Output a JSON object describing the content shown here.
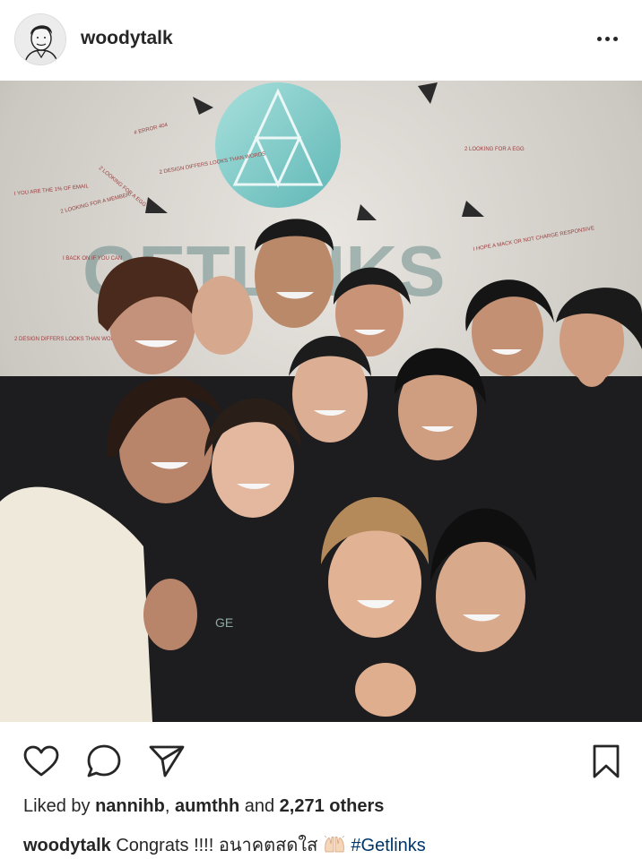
{
  "post": {
    "username": "woodytalk",
    "more_icon": "more-horizontal-icon"
  },
  "photo": {
    "wall_sign": "GETLINKS",
    "shirt_print": "GE",
    "wall_stickers": [
      "# ERROR 404",
      "2 LOOKING FOR A EGG",
      "2 DESIGN DIFFERS LOOKS THAN WORDS",
      "2 LOOKING FOR A MEMBER",
      "I BACK ON IF YOU CAN",
      "I HOPE A MACK OR NOT CHARGE RESPONSIVE",
      "2 DESIGN DIFFERS LOOKS THAN WORDS",
      "I YOU ARE THE 1% OF EMAIL",
      "2 LOOKING FOR A EGG"
    ]
  },
  "actions": {
    "like_icon": "heart-icon",
    "comment_icon": "comment-icon",
    "share_icon": "paper-plane-icon",
    "save_icon": "bookmark-icon"
  },
  "likes": {
    "prefix": "Liked by ",
    "user1": "nannihb",
    "sep": ", ",
    "user2": "aumthh",
    "and": " and ",
    "count": "2,271 others"
  },
  "caption": {
    "username": "woodytalk",
    "text": " Congrats !!!! อนาคตสดใส ",
    "emoji": "raised-hands-emoji",
    "hashtag": "#Getlinks"
  }
}
